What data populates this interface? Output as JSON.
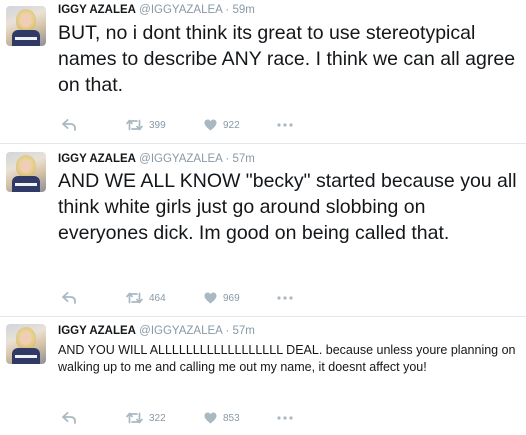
{
  "tweets": [
    {
      "name": "IGGY AZALEA",
      "handle": "@IGGYAZALEA",
      "dot": "·",
      "time": "59m",
      "text": "BUT, no i dont think its great to use stereotypical names to describe ANY race. I think we can all agree on that.",
      "retweets": "399",
      "likes": "922"
    },
    {
      "name": "IGGY AZALEA",
      "handle": "@IGGYAZALEA",
      "dot": "·",
      "time": "57m",
      "text": "AND WE ALL KNOW \"becky\" started because you all think white girls just go around slobbing on everyones dick. Im good on being called that.",
      "retweets": "464",
      "likes": "969"
    },
    {
      "name": "IGGY AZALEA",
      "handle": "@IGGYAZALEA",
      "dot": "·",
      "time": "57m",
      "text": "AND YOU WILL ALLLLLLLLLLLLLLLLLL DEAL. because unless youre planning on walking up to me and calling me out my name, it doesnt affect you!",
      "retweets": "322",
      "likes": "853"
    }
  ],
  "icons": {
    "reply": "reply-icon",
    "retweet": "retweet-icon",
    "like": "heart-icon",
    "more": "more-dots-icon"
  },
  "colors": {
    "text": "#14171a",
    "muted": "#8899a6",
    "icon": "#aab8c2",
    "divider": "#e1e8ed"
  }
}
